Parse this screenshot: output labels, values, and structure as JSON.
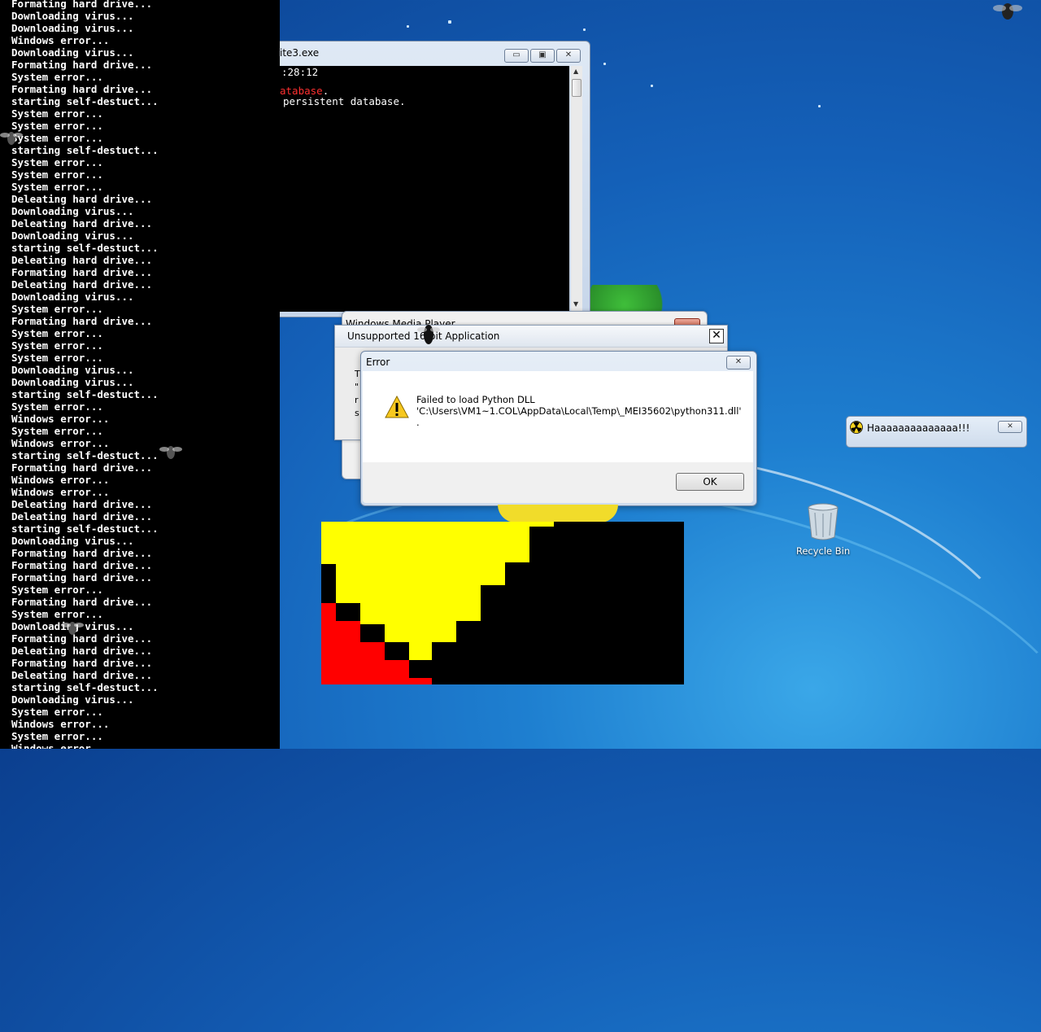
{
  "left_console": {
    "lines": [
      "Formating hard drive...",
      "Downloading virus...",
      "Downloading virus...",
      "Windows error...",
      "Downloading virus...",
      "Formating hard drive...",
      "System error...",
      "Formating hard drive...",
      "starting self-destuct...",
      "System error...",
      "System error...",
      "System error...",
      "starting self-destuct...",
      "System error...",
      "System error...",
      "System error...",
      "Deleating hard drive...",
      "Downloading virus...",
      "Deleating hard drive...",
      "Downloading virus...",
      "starting self-destuct...",
      "Deleating hard drive...",
      "Formating hard drive...",
      "Deleating hard drive...",
      "Downloading virus...",
      "System error...",
      "Formating hard drive...",
      "System error...",
      "System error...",
      "System error...",
      "Downloading virus...",
      "Downloading virus...",
      "starting self-destuct...",
      "System error...",
      "Windows error...",
      "System error...",
      "Windows error...",
      "starting self-destuct...",
      "Formating hard drive...",
      "Windows error...",
      "Windows error...",
      "Deleating hard drive...",
      "Deleating hard drive...",
      "starting self-destuct...",
      "Downloading virus...",
      "Formating hard drive...",
      "Formating hard drive...",
      "Formating hard drive...",
      "System error...",
      "Formating hard drive...",
      "System error...",
      "Downloading virus...",
      "Formating hard drive...",
      "Deleating hard drive...",
      "Formating hard drive...",
      "Deleating hard drive...",
      "starting self-destuct...",
      "Downloading virus...",
      "System error...",
      "Windows error...",
      "System error...",
      "Windows error..."
    ]
  },
  "console_window": {
    "title": "ite3.exe",
    "line1": ":28:12",
    "line2_red": "atabase",
    "line2_rest": ".",
    "line3": "persistent database.",
    "minimize": "▭",
    "maximize": "▣",
    "close": "✕"
  },
  "wmp_window": {
    "title": "Windows Media Player"
  },
  "unsupported_window": {
    "title": "Unsupported 16-bit Application",
    "close": "✕",
    "body_lines": [
      "T",
      "\"",
      "r",
      "s"
    ]
  },
  "error_dialog": {
    "title": "Error",
    "close": "✕",
    "message_line1": "Failed to load Python DLL",
    "message_line2": "'C:\\Users\\VM1~1.COL\\AppData\\Local\\Temp\\_MEI35602\\python311.dll'",
    "message_line3": ".",
    "ok_label": "OK",
    "icon": "warning-icon"
  },
  "haa_popup": {
    "title": "Haaaaaaaaaaaaaa!!!",
    "close": "✕",
    "icon": "radiation-icon"
  },
  "desktop": {
    "recycle_bin_label": "Recycle Bin"
  },
  "colors": {
    "desktop_blue": "#1460b8",
    "console_bg": "#000000",
    "error_red": "#ff3030",
    "pixel_yellow": "#ffff00",
    "pixel_red": "#ff0000"
  }
}
